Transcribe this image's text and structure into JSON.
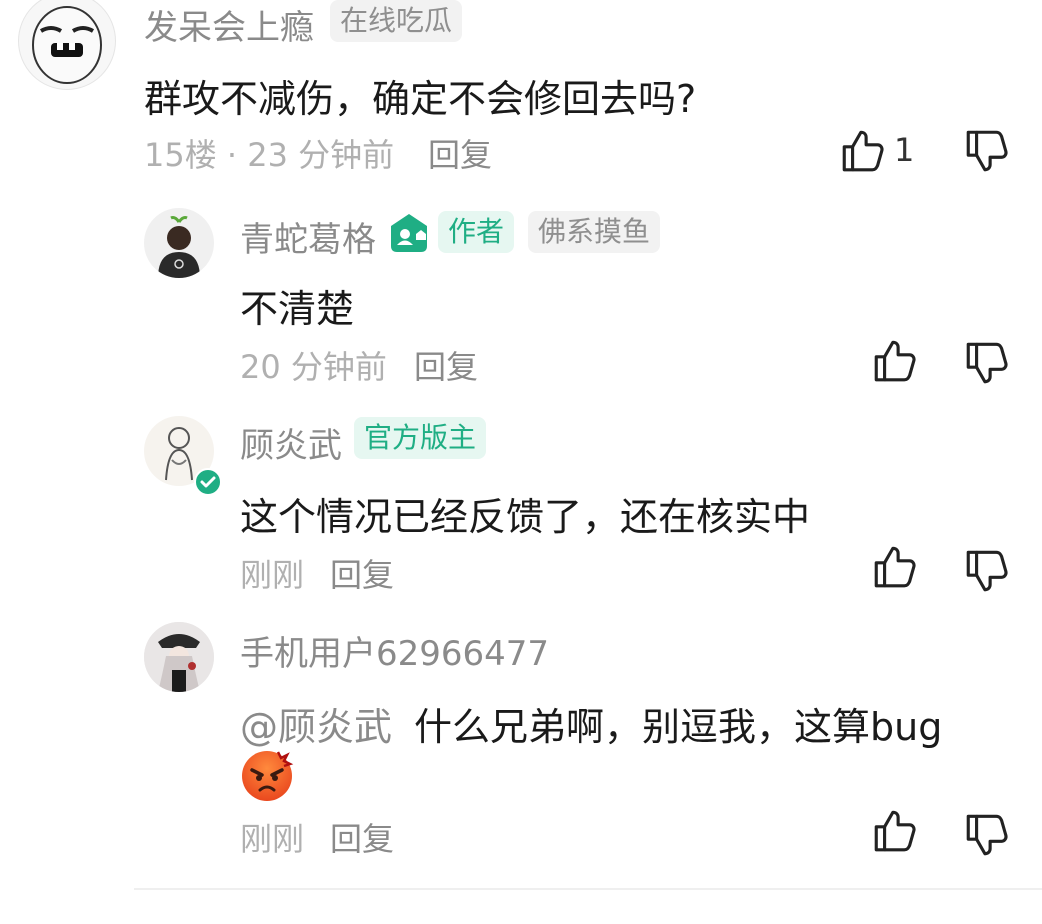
{
  "comments": [
    {
      "username": "发呆会上瘾",
      "badges": [
        "在线吃瓜"
      ],
      "content": "群攻不减伤，确定不会修回去吗?",
      "floor": "15楼",
      "separator": "·",
      "time": "23 分钟前",
      "reply_label": "回复",
      "like_count": "1",
      "replies": [
        {
          "username": "青蛇葛格",
          "author_badge": "作者",
          "badges": [
            "佛系摸鱼"
          ],
          "content": "不清楚",
          "time": "20 分钟前",
          "reply_label": "回复"
        },
        {
          "username": "顾炎武",
          "badges": [
            "官方版主"
          ],
          "content": "这个情况已经反馈了，还在核实中",
          "time": "刚刚",
          "reply_label": "回复"
        },
        {
          "username": "手机用户62966477",
          "mention": "@顾炎武",
          "content": "什么兄弟啊，别逗我，这算bug",
          "time": "刚刚",
          "reply_label": "回复"
        }
      ]
    }
  ],
  "colors": {
    "accent_green": "#1fae84",
    "gray_text": "#8a8a8a",
    "light_text": "#b0b0b0"
  },
  "icons": [
    "thumb-up-icon",
    "thumb-down-icon",
    "author-house-icon",
    "verified-check-icon",
    "angry-emoji-icon"
  ]
}
